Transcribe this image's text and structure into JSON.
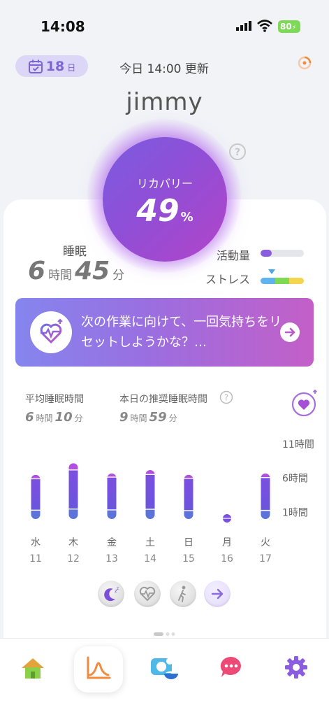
{
  "status_bar": {
    "time": "14:08",
    "battery": "80"
  },
  "header": {
    "date_number": "18",
    "date_unit": "日",
    "update_text": "今日 14:00 更新",
    "username": "jimmy"
  },
  "recovery": {
    "label": "リカバリー",
    "value": "49",
    "unit": "%"
  },
  "sleep": {
    "label": "睡眠",
    "hours": "6",
    "hours_unit": "時間",
    "minutes": "45",
    "minutes_unit": "分"
  },
  "activity": {
    "label": "活動量",
    "level": 0.25,
    "color": "#8a5de0"
  },
  "stress": {
    "label": "ストレス",
    "segment_colors": [
      "#5fb4f0",
      "#7ed957",
      "#f5d54b"
    ],
    "marker_position": 0.25
  },
  "banner": {
    "text": "次の作業に向けて、一回気持ちをリセットしようかな？…"
  },
  "stats": {
    "avg_label": "平均睡眠時間",
    "avg_hours": "6",
    "avg_minutes": "10",
    "rec_label": "本日の推奨睡眠時間",
    "rec_hours": "9",
    "rec_minutes": "59",
    "hours_unit": "時間",
    "minutes_unit": "分"
  },
  "chart_data": {
    "type": "bar",
    "y_tick_labels": [
      "11時間",
      "6時間",
      "1時間"
    ],
    "y_tick_values": [
      11,
      6,
      1
    ],
    "categories": [
      {
        "day": "水",
        "date": "11"
      },
      {
        "day": "木",
        "date": "12"
      },
      {
        "day": "金",
        "date": "13"
      },
      {
        "day": "土",
        "date": "14"
      },
      {
        "day": "日",
        "date": "15"
      },
      {
        "day": "月",
        "date": "16"
      },
      {
        "day": "火",
        "date": "17"
      }
    ],
    "values": [
      6.5,
      8.2,
      6.7,
      7.2,
      6.5,
      0.1,
      6.7
    ],
    "segments_light_fraction": [
      0.09,
      0.12,
      0.08,
      0.09,
      0.08,
      0.0,
      0.09
    ],
    "segments_deep_fraction": [
      0.2,
      0.18,
      0.2,
      0.2,
      0.19,
      0.0,
      0.19
    ],
    "colors": {
      "top": "#b14fe0",
      "mid": "#7b4fe0",
      "bottom": "#5c73d9"
    }
  },
  "nav": {
    "active": "trends"
  }
}
